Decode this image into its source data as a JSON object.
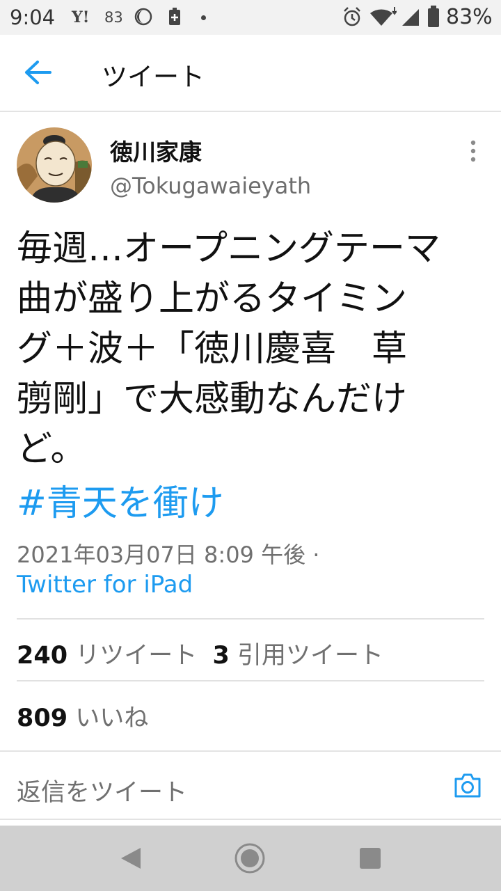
{
  "status_bar": {
    "time": "9:04",
    "yahoo_label": "Y!",
    "notification_count": "83",
    "battery_percent": "83%"
  },
  "header": {
    "title": "ツイート"
  },
  "tweet": {
    "author_name": "徳川家康",
    "author_handle": "@Tokugawaieyath",
    "lines": [
      "毎週…オープニングテーマ",
      "曲が盛り上がるタイミン",
      "グ＋波＋「徳川慶喜　草",
      "彅剛」で大感動なんだけ",
      "ど。"
    ],
    "hashtag": "#青天を衝け",
    "timestamp": "2021年03月07日 8:09 午後 ·",
    "source": "Twitter for iPad"
  },
  "stats": {
    "retweets_count": "240",
    "retweets_label": "リツイート",
    "quotes_count": "3",
    "quotes_label": "引用ツイート",
    "likes_count": "809",
    "likes_label": "いいね"
  },
  "reply": {
    "placeholder": "返信をツイート"
  },
  "colors": {
    "link": "#1d9bf0",
    "secondary_text": "#707070",
    "nav_bar": "#d0d0d0"
  },
  "icons": [
    "back-arrow-icon",
    "more-vertical-icon",
    "camera-icon",
    "alarm-icon",
    "wifi-icon",
    "signal-icon",
    "battery-icon",
    "moon-icon"
  ]
}
